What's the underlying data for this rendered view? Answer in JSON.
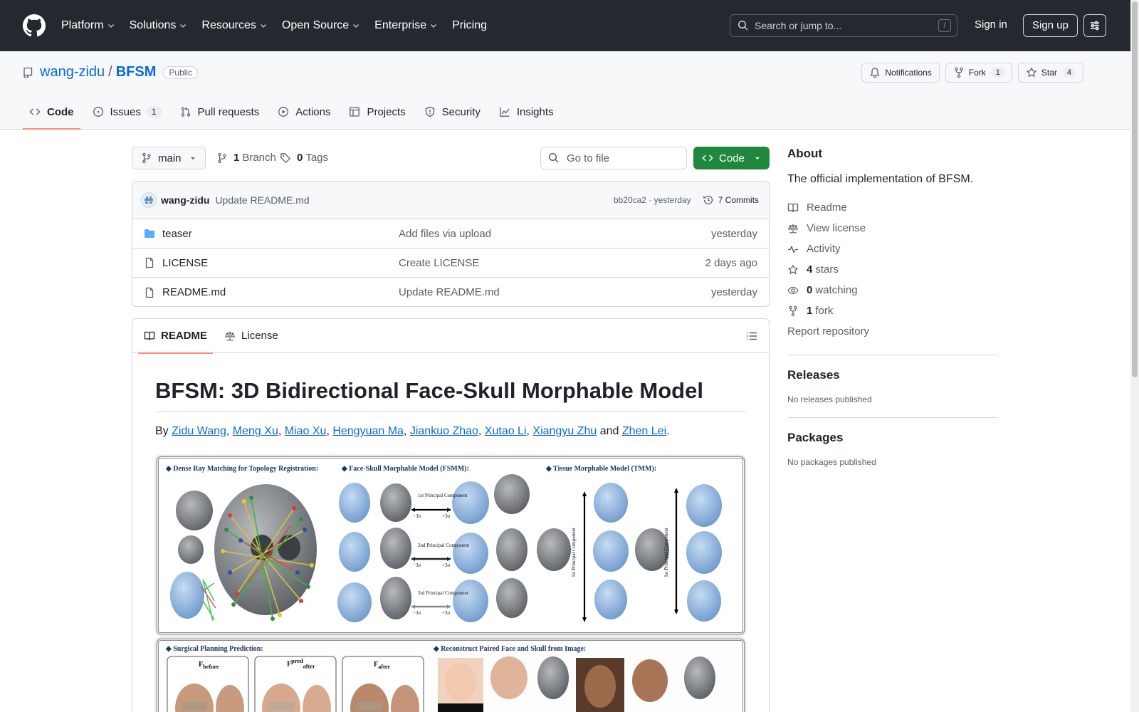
{
  "header": {
    "nav": [
      {
        "label": "Platform",
        "dropdown": true
      },
      {
        "label": "Solutions",
        "dropdown": true
      },
      {
        "label": "Resources",
        "dropdown": true
      },
      {
        "label": "Open Source",
        "dropdown": true
      },
      {
        "label": "Enterprise",
        "dropdown": true
      },
      {
        "label": "Pricing",
        "dropdown": false
      }
    ],
    "search_placeholder": "Search or jump to...",
    "search_shortcut": "/",
    "signin": "Sign in",
    "signup": "Sign up"
  },
  "repo": {
    "owner": "wang-zidu",
    "separator": "/",
    "name": "BFSM",
    "visibility": "Public",
    "notifications_label": "Notifications",
    "fork_label": "Fork",
    "fork_count": "1",
    "star_label": "Star",
    "star_count": "4",
    "tabs": [
      {
        "label": "Code",
        "icon": "code-icon",
        "active": true,
        "count": ""
      },
      {
        "label": "Issues",
        "icon": "issue-icon",
        "active": false,
        "count": "1"
      },
      {
        "label": "Pull requests",
        "icon": "pull-request-icon",
        "active": false,
        "count": ""
      },
      {
        "label": "Actions",
        "icon": "play-icon",
        "active": false,
        "count": ""
      },
      {
        "label": "Projects",
        "icon": "table-icon",
        "active": false,
        "count": ""
      },
      {
        "label": "Security",
        "icon": "shield-icon",
        "active": false,
        "count": ""
      },
      {
        "label": "Insights",
        "icon": "graph-icon",
        "active": false,
        "count": ""
      }
    ]
  },
  "branchbar": {
    "branch": "main",
    "branch_count": "1",
    "branch_label": "Branch",
    "tag_count": "0",
    "tag_label": "Tags",
    "goto_placeholder": "Go to file",
    "code_button": "Code"
  },
  "latest_commit": {
    "author": "wang-zidu",
    "message": "Update README.md",
    "hash_time": "bb20ca2 · yesterday",
    "commits_label": "7 Commits"
  },
  "files": [
    {
      "name": "teaser",
      "type": "folder",
      "message": "Add files via upload",
      "date": "yesterday"
    },
    {
      "name": "LICENSE",
      "type": "file",
      "message": "Create LICENSE",
      "date": "2 days ago"
    },
    {
      "name": "README.md",
      "type": "file",
      "message": "Update README.md",
      "date": "yesterday"
    }
  ],
  "readme": {
    "tabs": [
      "README",
      "License"
    ],
    "title": "BFSM: 3D Bidirectional Face-Skull Morphable Model",
    "authors_prefix": "By",
    "authors": [
      "Zidu Wang",
      "Meng Xu",
      "Miao Xu",
      "Hengyuan Ma",
      "Jiankuo Zhao",
      "Xutao Li",
      "Xiangyu Zhu"
    ],
    "authors_and": "and",
    "author_last": "Zhen Lei",
    "authors_end": ".",
    "figure": {
      "dense_ray": "Dense Ray Matching for Topology Registration:",
      "fsmm": "Face-Skull Morphable Model (FSMM):",
      "tmm": "Tissue Morphable Model (TMM):",
      "surgical": "Surgical Planning Prediction:",
      "reconstruct": "Reconstruct Paired Face and Skull from Image:",
      "pc1": "1st Principal Component",
      "pc2": "2nd Principal Component",
      "pc3": "3rd Principal Component",
      "minus": "−3σ",
      "plus": "+3σ",
      "tmm_axis_left": "1st Principal Component",
      "tmm_axis_right": "1st Principal Component",
      "f_before": "F",
      "f_before_sub": "before",
      "f_pred": "F",
      "f_pred_sup": "pred",
      "f_pred_sub": "after",
      "f_after": "F",
      "f_after_sub": "after"
    }
  },
  "sidebar": {
    "about_title": "About",
    "description": "The official implementation of BFSM.",
    "links": [
      {
        "icon": "book-icon",
        "bold": "",
        "label": "Readme"
      },
      {
        "icon": "law-icon",
        "bold": "",
        "label": "View license"
      },
      {
        "icon": "pulse-icon",
        "bold": "",
        "label": "Activity"
      },
      {
        "icon": "star-icon",
        "bold": "4",
        "label": "stars"
      },
      {
        "icon": "eye-icon",
        "bold": "0",
        "label": "watching"
      },
      {
        "icon": "fork-icon",
        "bold": "1",
        "label": "fork"
      }
    ],
    "report": "Report repository",
    "releases_title": "Releases",
    "releases_none": "No releases published",
    "packages_title": "Packages",
    "packages_none": "No packages published"
  },
  "colors": {
    "header_bg": "#24292f",
    "link": "#0969da",
    "code_button": "#1f883d",
    "tab_underline": "#fd8c73",
    "face_blue": "#8fb3de",
    "skull_gray": "#7b7e83"
  }
}
